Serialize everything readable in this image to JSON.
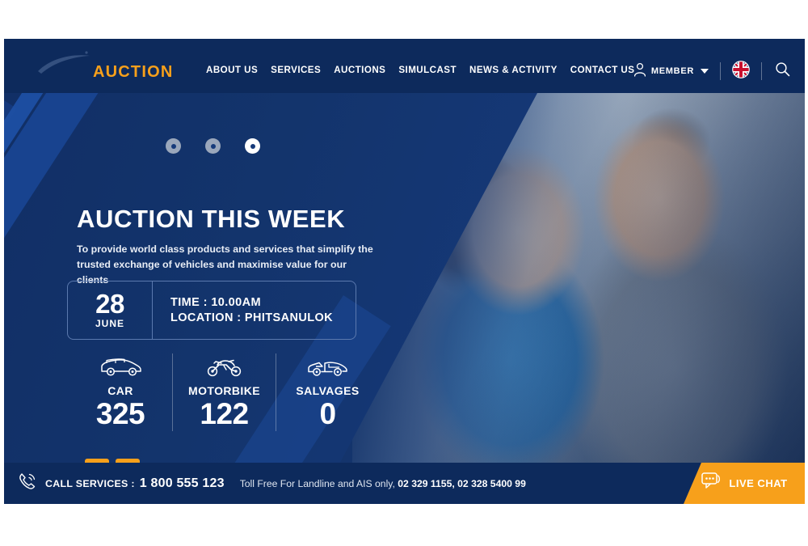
{
  "header": {
    "brand": "AUCTION",
    "logo_icon": "swoosh-logo-icon",
    "nav": [
      {
        "label": "ABOUT US"
      },
      {
        "label": "SERVICES"
      },
      {
        "label": "AUCTIONS"
      },
      {
        "label": "SIMULCAST"
      },
      {
        "label": "NEWS & ACTIVITY"
      },
      {
        "label": "CONTACT US"
      }
    ],
    "member_label": "MEMBER",
    "member_icon": "user-icon",
    "member_caret_icon": "chevron-down-icon",
    "language_icon": "uk-flag-icon",
    "search_icon": "search-icon",
    "background_color": "#0d2a5c",
    "accent_color": "#f7a01b"
  },
  "hero": {
    "dots": [
      {
        "state": "inactive"
      },
      {
        "state": "inactive"
      },
      {
        "state": "active"
      }
    ],
    "title": "AUCTION THIS WEEK",
    "subtitle": "To provide world class products and services that simplify the trusted exchange of vehicles and maximise value for our clients",
    "event": {
      "day": "28",
      "month": "JUNE",
      "time_line": "TIME : 10.00AM",
      "location_line": "LOCATION : PHITSANULOK"
    },
    "stats": [
      {
        "icon": "car-icon",
        "label": "CAR",
        "value": "325"
      },
      {
        "icon": "motorbike-icon",
        "label": "MOTORBIKE",
        "value": "122"
      },
      {
        "icon": "salvage-car-icon",
        "label": "SALVAGES",
        "value": "0"
      }
    ],
    "prev_icon": "chevron-left-icon",
    "next_icon": "chevron-right-icon"
  },
  "footer": {
    "phone_icon": "phone-ring-icon",
    "call_label": "CALL SERVICES :",
    "call_number": "1 800 555 123",
    "note_prefix": "Toll Free For Landline and AIS only,",
    "note_numbers": "02 329 1155, 02 328 5400 99",
    "livechat_label": "LIVE CHAT",
    "livechat_icon": "chat-bubble-icon",
    "livechat_color": "#f7a01b"
  }
}
